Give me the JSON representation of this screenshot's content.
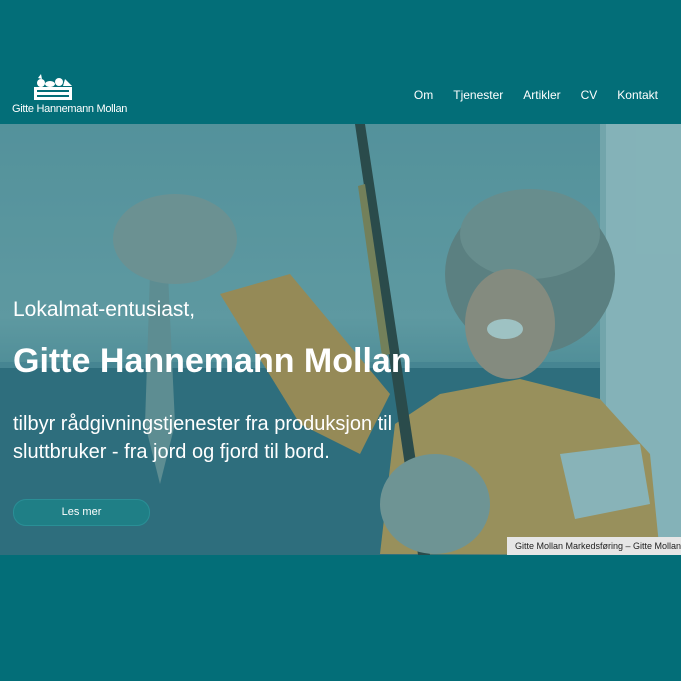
{
  "brand": {
    "logo_text": "Gitte Hannemann Mollan",
    "logo_icon": "crate-of-produce-icon"
  },
  "nav": {
    "items": [
      "Om",
      "Tjenester",
      "Artikler",
      "CV",
      "Kontakt"
    ]
  },
  "hero": {
    "intro": "Lokalmat-entusiast,",
    "title": "Gitte Hannemann Mollan",
    "description": "tilbyr rådgivningstjenester fra produksjon til sluttbruker - fra jord og fjord til bord.",
    "button_label": "Les mer",
    "image_caption": "Gitte Mollan Markedsføring – Gitte Mollan"
  },
  "colors": {
    "brand_teal": "#036e78",
    "button": "#1f7f86"
  }
}
